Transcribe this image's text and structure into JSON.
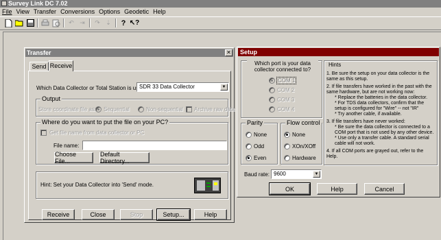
{
  "app": {
    "title": "Survey Link DC 7.02"
  },
  "menu": [
    "File",
    "View",
    "Transfer",
    "Conversions",
    "Options",
    "Geodetic",
    "Help"
  ],
  "toolbar": {
    "icons": [
      "new-icon",
      "open-icon",
      "save-icon",
      "print-icon",
      "print-preview-icon",
      "undo-icon",
      "redo-icon",
      "help-icon",
      "context-help-icon"
    ]
  },
  "transfer": {
    "title": "Transfer",
    "close_glyph": "✕",
    "tabs": [
      "Send",
      "Receive"
    ],
    "active_tab": "Receive",
    "collector_label": "Which Data Collector or Total Station is used:",
    "collector_value": "SDR 33 Data Collector",
    "output": {
      "label": "Output",
      "store_label": "Store coordinate file as:",
      "sequential": "Sequential",
      "non_sequential": "Non-sequential",
      "archive": "Archive raw data"
    },
    "where": {
      "label": "Where do you want to put the file on your PC?",
      "get_name": "Get file name from data collector or PC",
      "file_name_label": "File name:",
      "file_name_value": "",
      "choose_file": "Choose File...",
      "default_dir": "Default Directory..."
    },
    "hint": "Hint:  Set your Data Collector into 'Send' mode.",
    "buttons": {
      "receive": "Receive",
      "close": "Close",
      "stop": "Stop",
      "setup": "Setup...",
      "help": "Help"
    }
  },
  "setup": {
    "title": "Setup",
    "port_question": "Which port is your data collector connected to?",
    "ports": [
      "COM 1",
      "COM 2",
      "COM 3",
      "COM 4"
    ],
    "selected_port": "COM 1",
    "parity": {
      "label": "Parity",
      "options": [
        "None",
        "Odd",
        "Even"
      ],
      "selected": "Even"
    },
    "flow": {
      "label": "Flow control",
      "options": [
        "None",
        "XOn/XOff",
        "Hardware"
      ],
      "selected": "None"
    },
    "baud_label": "Baud rate:",
    "baud_value": "9600",
    "hints_title": "Hints",
    "hints": [
      "1. Be sure the setup on your data collector is the same as this setup.",
      "2. If file transfers have worked in the past with the same hardware, but are not working now:",
      "* Replace the batteries in the data collector.",
      "* For TDS data collectors, confirm that the setup is configured for \"Wire\" -- not \"IR\"",
      "* Try another cable, if available.",
      "3. If file transfers have never worked:",
      "* Be sure the data collector is connected to a COM port that is not used by any other device.",
      "* Use only a transfer cable. A standard serial cable will not work.",
      "4. If all COM ports are grayed out, refer to the Help."
    ],
    "buttons": {
      "ok": "OK",
      "help": "Help",
      "cancel": "Cancel"
    }
  },
  "colors": {
    "title_active": "#800000",
    "title_inactive": "#808080",
    "face": "#d4d0c8",
    "desktop": "#d4d0c8"
  }
}
